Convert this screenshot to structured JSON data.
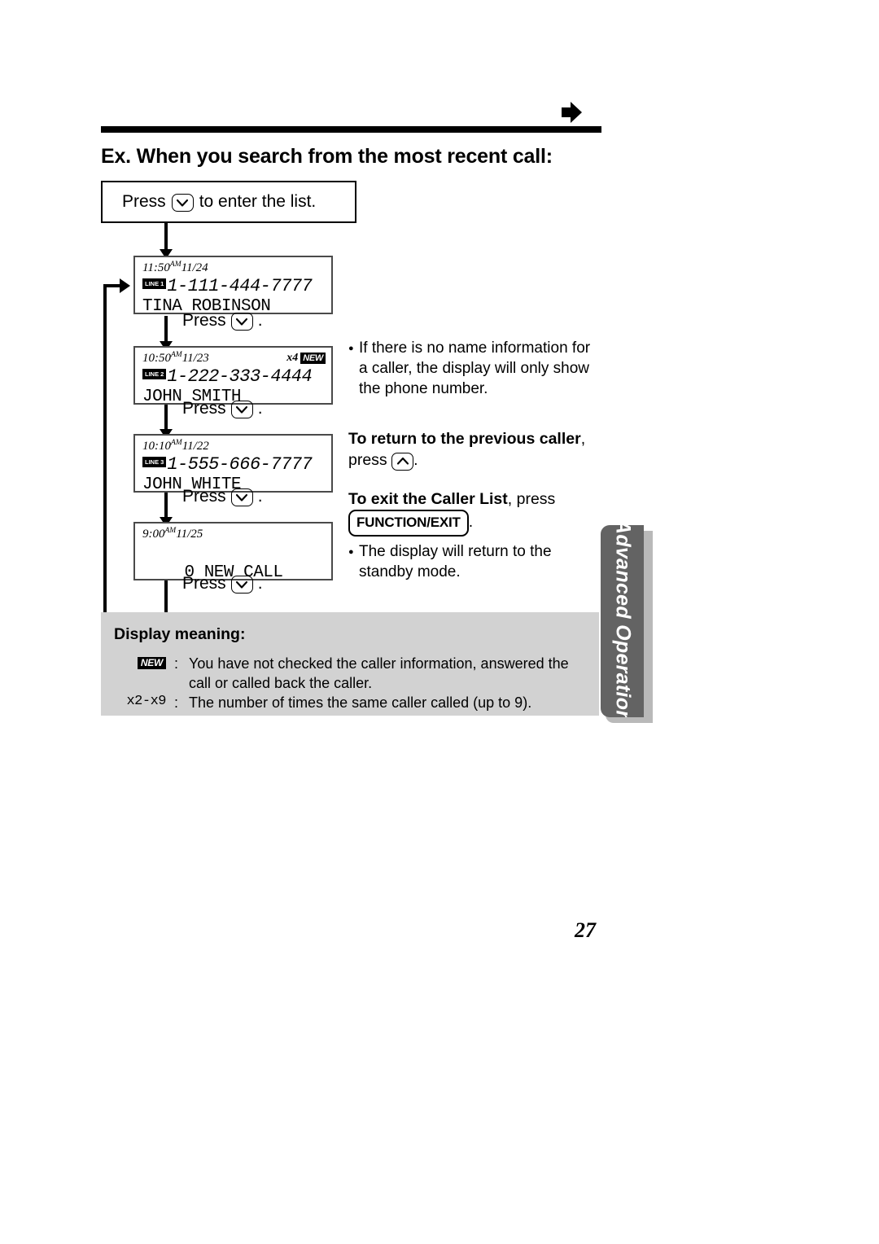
{
  "header": {
    "arrow_icon": "right-arrow-icon",
    "title": "Ex. When you search from the most recent call:"
  },
  "flow": {
    "enter_box": {
      "press_label": "Press",
      "key_icon": "down-arrow-key",
      "after_label": "to enter the list."
    },
    "steps": [
      {
        "time": "11:50",
        "ampm": "AM",
        "date": "11/24",
        "count": "",
        "new_badge": "",
        "line_badge": "LINE 1",
        "number": "1-111-444-7777",
        "name": "TINA ROBINSON",
        "press_label": "Press",
        "press_key": "down-arrow-key",
        "press_suffix": "."
      },
      {
        "time": "10:50",
        "ampm": "AM",
        "date": "11/23",
        "count": "x4",
        "new_badge": "NEW",
        "line_badge": "LINE 2",
        "number": "1-222-333-4444",
        "name": "JOHN SMITH",
        "press_label": "Press",
        "press_key": "down-arrow-key",
        "press_suffix": "."
      },
      {
        "time": "10:10",
        "ampm": "AM",
        "date": "11/22",
        "count": "",
        "new_badge": "",
        "line_badge": "LINE 3",
        "number": "1-555-666-7777",
        "name": "JOHN WHITE",
        "press_label": "Press",
        "press_key": "down-arrow-key",
        "press_suffix": "."
      },
      {
        "time": "9:00",
        "ampm": "AM",
        "date": "11/25",
        "count": "",
        "new_badge": "",
        "line_badge": "",
        "number": "",
        "name": "0 NEW CALL",
        "press_label": "Press",
        "press_key": "down-arrow-key",
        "press_suffix": "."
      }
    ]
  },
  "notes": {
    "no_name_note": "If there is no name information for a caller, the display will only show the phone number.",
    "return_bold": "To return to the previous caller",
    "return_rest": ", press",
    "return_key": "up-arrow-key",
    "return_period": ".",
    "exit_bold": "To exit the Caller List",
    "exit_rest": ", press",
    "exit_button": "FUNCTION/EXIT",
    "exit_period": ".",
    "standby_note": "The display will return to the standby mode."
  },
  "display_meaning": {
    "title": "Display meaning:",
    "rows": [
      {
        "key": "NEW",
        "key_type": "badge",
        "colon": ":",
        "text": "You have not checked the caller information, answered the call or called back the caller."
      },
      {
        "key": "x2-x9",
        "key_type": "mono",
        "colon": ":",
        "text": "The number of times the same caller called (up to 9)."
      }
    ]
  },
  "side_tab": {
    "label": "Advanced Operation",
    "bg_color": "#636363",
    "text_color": "#ffffff"
  },
  "page_number": "27"
}
